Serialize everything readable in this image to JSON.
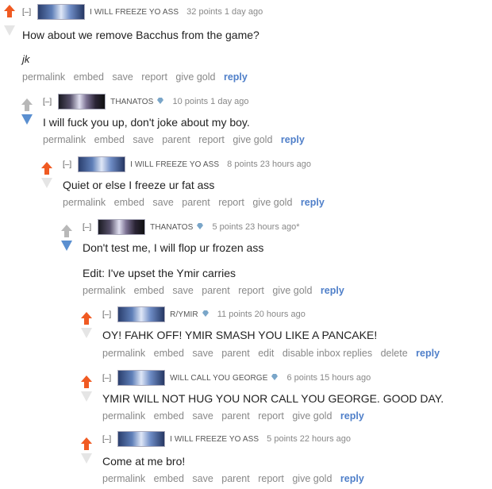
{
  "comments": [
    {
      "expand": "[–]",
      "author": "I WILL FREEZE YO ASS",
      "gem": "",
      "score": "32 points 1 day ago",
      "lines": [
        "How about we remove Bacchus from the game?",
        "jk"
      ],
      "buttons": [
        "permalink",
        "embed",
        "save",
        "report",
        "give gold"
      ],
      "reply": "reply",
      "vote": "up"
    },
    {
      "expand": "[–]",
      "author": "THANATOS",
      "gem": "diamond",
      "score": "10 points 1 day ago",
      "lines": [
        "I will fuck you up, don't joke about my boy."
      ],
      "buttons": [
        "permalink",
        "embed",
        "save",
        "parent",
        "report",
        "give gold"
      ],
      "reply": "reply",
      "vote": "down"
    },
    {
      "expand": "[–]",
      "author": "I WILL FREEZE YO ASS",
      "gem": "",
      "score": "8 points 23 hours ago",
      "lines": [
        "Quiet or else I freeze ur fat ass"
      ],
      "buttons": [
        "permalink",
        "embed",
        "save",
        "parent",
        "report",
        "give gold"
      ],
      "reply": "reply",
      "vote": "up"
    },
    {
      "expand": "[–]",
      "author": "THANATOS",
      "gem": "diamond",
      "score": "5 points 23 hours ago*",
      "lines": [
        "Don't test me, I will flop ur frozen ass",
        "Edit: I've upset the Ymir carries"
      ],
      "buttons": [
        "permalink",
        "embed",
        "save",
        "parent",
        "report",
        "give gold"
      ],
      "reply": "reply",
      "vote": "down"
    },
    {
      "expand": "[–]",
      "author": "R/YMIR",
      "gem": "diamond",
      "score": "11 points 20 hours ago",
      "lines": [
        "OY! FAHK OFF! YMIR SMASH YOU LIKE A PANCAKE!"
      ],
      "buttons": [
        "permalink",
        "embed",
        "save",
        "parent",
        "edit",
        "disable inbox replies",
        "delete"
      ],
      "reply": "reply",
      "vote": "up"
    },
    {
      "expand": "[–]",
      "author": "WILL CALL YOU GEORGE",
      "gem": "diamond",
      "score": "6 points 15 hours ago",
      "lines": [
        "YMIR WILL NOT HUG YOU NOR CALL YOU GEORGE. GOOD DAY."
      ],
      "buttons": [
        "permalink",
        "embed",
        "save",
        "parent",
        "report",
        "give gold"
      ],
      "reply": "reply",
      "vote": "up"
    },
    {
      "expand": "[–]",
      "author": "I WILL FREEZE YO ASS",
      "gem": "",
      "score": "5 points 22 hours ago",
      "lines": [
        "Come at me bro!"
      ],
      "buttons": [
        "permalink",
        "embed",
        "save",
        "parent",
        "report",
        "give gold"
      ],
      "reply": "reply",
      "vote": "up"
    }
  ],
  "colors": {
    "upvote": "#f05a22",
    "downvote": "#5a8fd0",
    "neutral": "#c6c6c6",
    "reply_link": "#4f7fc9"
  }
}
